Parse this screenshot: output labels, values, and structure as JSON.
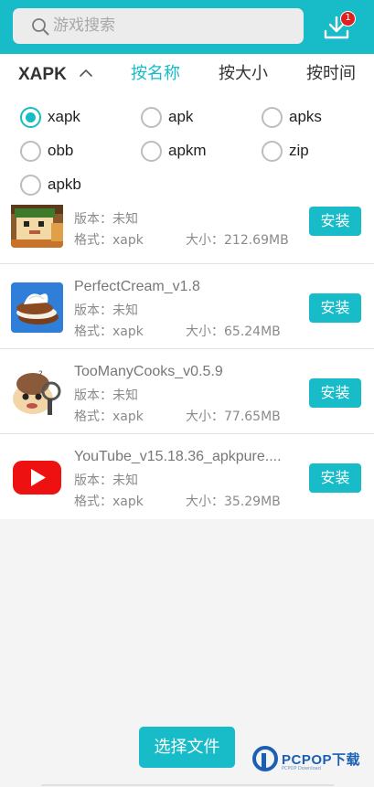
{
  "search": {
    "placeholder": "游戏搜索",
    "icon": "search-icon"
  },
  "download": {
    "icon": "download-icon",
    "badge_count": "1",
    "badge_color": "#e02020"
  },
  "accent_color": "#17bcc8",
  "sort_bar": {
    "type_selector": "XAPK",
    "tabs": [
      {
        "label": "按名称",
        "active": true
      },
      {
        "label": "按大小",
        "active": false
      },
      {
        "label": "按时间",
        "active": false
      }
    ]
  },
  "filters": [
    {
      "label": "xapk",
      "checked": true
    },
    {
      "label": "apk",
      "checked": false
    },
    {
      "label": "apks",
      "checked": false
    },
    {
      "label": "obb",
      "checked": false
    },
    {
      "label": "apkm",
      "checked": false
    },
    {
      "label": "zip",
      "checked": false
    },
    {
      "label": "apkb",
      "checked": false
    }
  ],
  "files": [
    {
      "name": "",
      "version_label": "版本：",
      "version": "未知",
      "format_label": "格式：",
      "format": "xapk",
      "size_label": "大小：",
      "size": "212.69MB",
      "install_label": "安装",
      "thumb": "pixel-hero-game-icon"
    },
    {
      "name": "PerfectCream_v1.8",
      "version_label": "版本：",
      "version": "未知",
      "format_label": "格式：",
      "format": "xapk",
      "size_label": "大小：",
      "size": "65.24MB",
      "install_label": "安装",
      "thumb": "cream-eclair-icon"
    },
    {
      "name": "TooManyCooks_v0.5.9",
      "version_label": "版本：",
      "version": "未知",
      "format_label": "格式：",
      "format": "xapk",
      "size_label": "大小：",
      "size": "77.65MB",
      "install_label": "安装",
      "thumb": "cook-character-icon"
    },
    {
      "name": "YouTube_v15.18.36_apkpure....",
      "version_label": "版本：",
      "version": "未知",
      "format_label": "格式：",
      "format": "xapk",
      "size_label": "大小：",
      "size": "35.29MB",
      "install_label": "安装",
      "thumb": "youtube-icon"
    }
  ],
  "choose_file_label": "选择文件",
  "watermark": {
    "text": "PCPOP下载",
    "sub": "PCPOP Download"
  }
}
